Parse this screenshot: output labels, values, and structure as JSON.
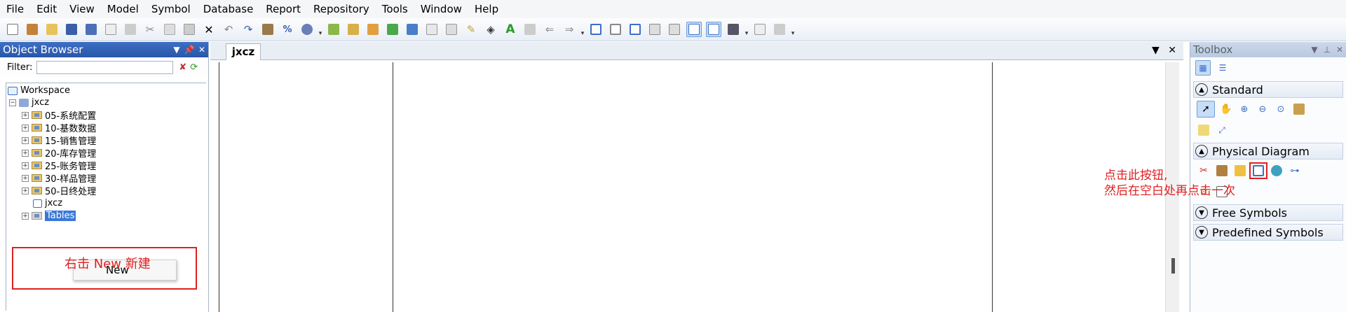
{
  "menubar": {
    "items": [
      "File",
      "Edit",
      "View",
      "Model",
      "Symbol",
      "Database",
      "Report",
      "Repository",
      "Tools",
      "Window",
      "Help"
    ]
  },
  "object_browser": {
    "title": "Object Browser",
    "filter_label": "Filter:",
    "filter_value": "",
    "tree": {
      "workspace": "Workspace",
      "model": "jxcz",
      "packages": [
        "05-系统配置",
        "10-基数数据",
        "15-销售管理",
        "20-库存管理",
        "25-账务管理",
        "30-样品管理",
        "50-日终处理"
      ],
      "diagram": "jxcz",
      "tables": "Tables"
    },
    "context_menu": {
      "new_label": "New"
    },
    "annotation": "右击 New 新建"
  },
  "diagram": {
    "tab_label": "jxcz"
  },
  "toolbox": {
    "title": "Toolbox",
    "categories": {
      "standard": "Standard",
      "physical": "Physical Diagram",
      "free": "Free Symbols",
      "predefined": "Predefined Symbols"
    },
    "annotation_line1": "点击此按钮,",
    "annotation_line2": "然后在空白处再点击一次"
  },
  "colors": {
    "annotation_red": "#e02020",
    "title_blue": "#2956a8",
    "selection": "#3b78d6"
  }
}
